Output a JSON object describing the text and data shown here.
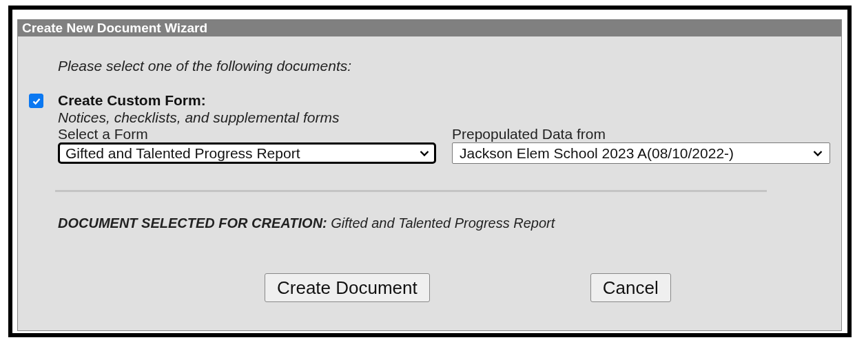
{
  "window": {
    "title": "Create New Document Wizard"
  },
  "intro": "Please select one of the following documents:",
  "option": {
    "checked": true,
    "label": "Create Custom Form:",
    "description": "Notices, checklists, and supplemental forms"
  },
  "selects": [
    {
      "label": "Select a Form",
      "value": "Gifted and Talented Progress Report",
      "focused": true
    },
    {
      "label": "Prepopulated Data from",
      "value": "Jackson Elem School 2023 A(08/10/2022-)",
      "focused": false
    }
  ],
  "selection_note": "**DOCUMENT SELECTED FOR CREATION:** Gifted and Talented Progress Report",
  "buttons": [
    "Create Document",
    "Cancel"
  ]
}
